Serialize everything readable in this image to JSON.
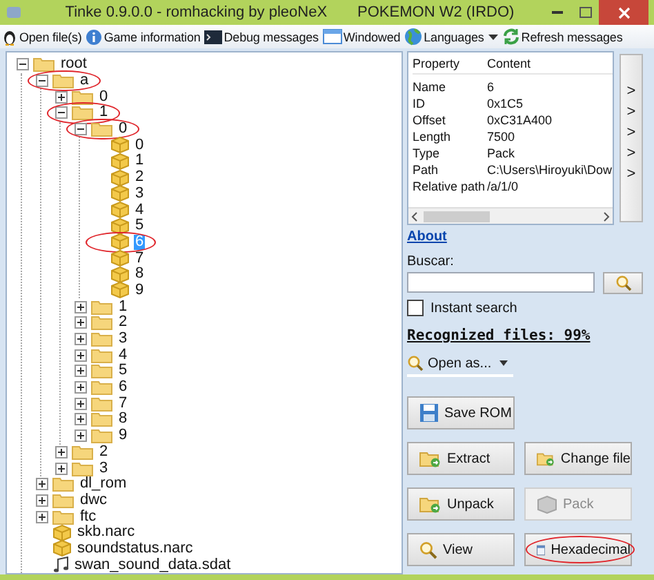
{
  "window": {
    "title": "Tinke 0.9.0.0 - romhacking by pleoNeX",
    "game": "POKEMON W2 (IRDO)"
  },
  "toolbar": [
    {
      "label": "Open file(s)",
      "kind": "open"
    },
    {
      "label": "Game information",
      "kind": "info"
    },
    {
      "label": "Debug messages",
      "kind": "console"
    },
    {
      "label": "Windowed",
      "kind": "window"
    },
    {
      "label": "Languages",
      "kind": "globe",
      "dropdown": true
    },
    {
      "label": "Refresh messages",
      "kind": "refresh"
    }
  ],
  "tree": [
    {
      "label": "root",
      "kind": "folder",
      "expanded": true,
      "selected": false,
      "circled": false,
      "children": [
        {
          "label": "a",
          "kind": "folder",
          "expanded": true,
          "selected": false,
          "circled": true,
          "children": [
            {
              "label": "0",
              "kind": "folder",
              "expanded": false,
              "selected": false,
              "circled": false
            },
            {
              "label": "1",
              "kind": "folder",
              "expanded": true,
              "selected": false,
              "circled": true,
              "children": [
                {
                  "label": "0",
                  "kind": "folder",
                  "expanded": true,
                  "selected": false,
                  "circled": true,
                  "children": [
                    {
                      "label": "0",
                      "kind": "pack",
                      "selected": false,
                      "circled": false
                    },
                    {
                      "label": "1",
                      "kind": "pack",
                      "selected": false,
                      "circled": false
                    },
                    {
                      "label": "2",
                      "kind": "pack",
                      "selected": false,
                      "circled": false
                    },
                    {
                      "label": "3",
                      "kind": "pack",
                      "selected": false,
                      "circled": false
                    },
                    {
                      "label": "4",
                      "kind": "pack",
                      "selected": false,
                      "circled": false
                    },
                    {
                      "label": "5",
                      "kind": "pack",
                      "selected": false,
                      "circled": false
                    },
                    {
                      "label": "6",
                      "kind": "pack",
                      "selected": true,
                      "circled": true
                    },
                    {
                      "label": "7",
                      "kind": "pack",
                      "selected": false,
                      "circled": false
                    },
                    {
                      "label": "8",
                      "kind": "pack",
                      "selected": false,
                      "circled": false
                    },
                    {
                      "label": "9",
                      "kind": "pack",
                      "selected": false,
                      "circled": false
                    }
                  ]
                },
                {
                  "label": "1",
                  "kind": "folder",
                  "expanded": false,
                  "selected": false,
                  "circled": false
                },
                {
                  "label": "2",
                  "kind": "folder",
                  "expanded": false,
                  "selected": false,
                  "circled": false
                },
                {
                  "label": "3",
                  "kind": "folder",
                  "expanded": false,
                  "selected": false,
                  "circled": false
                },
                {
                  "label": "4",
                  "kind": "folder",
                  "expanded": false,
                  "selected": false,
                  "circled": false
                },
                {
                  "label": "5",
                  "kind": "folder",
                  "expanded": false,
                  "selected": false,
                  "circled": false
                },
                {
                  "label": "6",
                  "kind": "folder",
                  "expanded": false,
                  "selected": false,
                  "circled": false
                },
                {
                  "label": "7",
                  "kind": "folder",
                  "expanded": false,
                  "selected": false,
                  "circled": false
                },
                {
                  "label": "8",
                  "kind": "folder",
                  "expanded": false,
                  "selected": false,
                  "circled": false
                },
                {
                  "label": "9",
                  "kind": "folder",
                  "expanded": false,
                  "selected": false,
                  "circled": false
                }
              ]
            },
            {
              "label": "2",
              "kind": "folder",
              "expanded": false,
              "selected": false,
              "circled": false
            },
            {
              "label": "3",
              "kind": "folder",
              "expanded": false,
              "selected": false,
              "circled": false
            }
          ]
        },
        {
          "label": "dl_rom",
          "kind": "folder",
          "expanded": false,
          "selected": false,
          "circled": false
        },
        {
          "label": "dwc",
          "kind": "folder",
          "expanded": false,
          "selected": false,
          "circled": false
        },
        {
          "label": "ftc",
          "kind": "folder",
          "expanded": false,
          "selected": false,
          "circled": false
        },
        {
          "label": "skb.narc",
          "kind": "pack",
          "selected": false,
          "circled": false
        },
        {
          "label": "soundstatus.narc",
          "kind": "pack",
          "selected": false,
          "circled": false
        },
        {
          "label": "swan_sound_data.sdat",
          "kind": "sound",
          "selected": false,
          "circled": false
        }
      ]
    }
  ],
  "properties": {
    "columns": [
      "Property",
      "Content"
    ],
    "rows": [
      [
        "Name",
        "6"
      ],
      [
        "ID",
        "0x1C5"
      ],
      [
        "Offset",
        "0xC31A400"
      ],
      [
        "Length",
        "7500"
      ],
      [
        "Type",
        "Pack"
      ],
      [
        "Path",
        "C:\\Users\\Hiroyuki\\Dow"
      ],
      [
        "Relative path",
        "/a/1/0"
      ]
    ]
  },
  "side_buttons": [
    ">",
    ">",
    ">",
    ">",
    ">"
  ],
  "about_link": "About",
  "search": {
    "label": "Buscar:"
  },
  "instant_search": {
    "label": "Instant search",
    "checked": false
  },
  "recognized": "Recognized files: 99%",
  "open_as": "Open as...",
  "button_rows": [
    [
      {
        "label": "Save ROM",
        "kind": "save",
        "disabled": false,
        "circled": false
      }
    ],
    [
      {
        "label": "Extract",
        "kind": "extract",
        "disabled": false,
        "circled": false
      },
      {
        "label": "Change file",
        "kind": "change",
        "disabled": false,
        "circled": false
      }
    ],
    [
      {
        "label": "Unpack",
        "kind": "unpack",
        "disabled": false,
        "circled": false
      },
      {
        "label": "Pack",
        "kind": "pack",
        "disabled": true,
        "circled": false
      }
    ],
    [
      {
        "label": "View",
        "kind": "view",
        "disabled": false,
        "circled": false
      },
      {
        "label": "Hexadecimal",
        "kind": "hex",
        "disabled": false,
        "circled": true
      }
    ]
  ]
}
